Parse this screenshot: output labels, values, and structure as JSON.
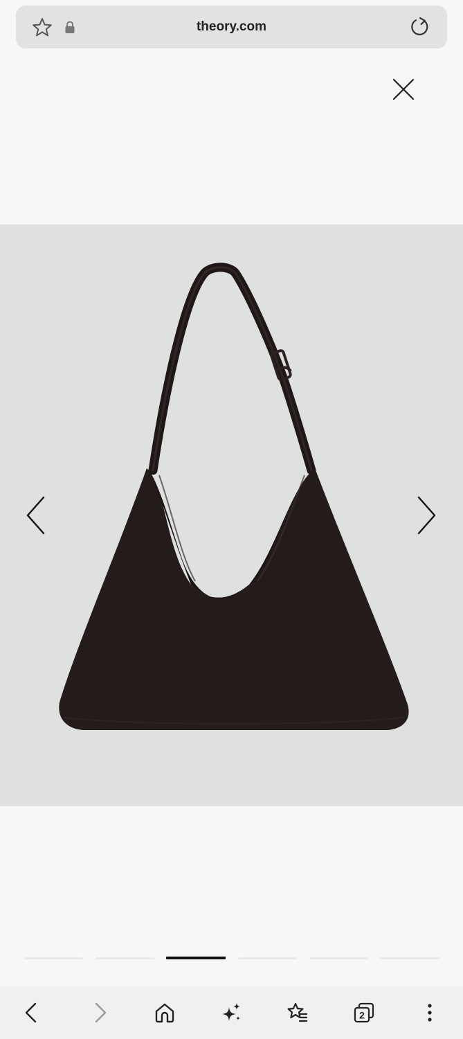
{
  "browser": {
    "url": "theory.com",
    "tab_count": "2"
  },
  "icons": {
    "favorite": "star-outline-icon",
    "secure": "lock-icon",
    "reload": "reload-icon",
    "close": "close-icon",
    "prev": "chevron-left-icon",
    "next": "chevron-right-icon",
    "back": "back-arrow-icon",
    "forward": "forward-arrow-icon",
    "home": "home-icon",
    "ai": "sparkle-icon",
    "bookmarks": "bookmarks-star-icon",
    "tabs": "tabs-icon",
    "menu": "more-vertical-icon"
  },
  "gallery": {
    "total_images": 6,
    "active_index": 2
  },
  "colors": {
    "gallery_background": "#dfe1e0",
    "bag": "#241c1b",
    "active_indicator": "#111111"
  }
}
